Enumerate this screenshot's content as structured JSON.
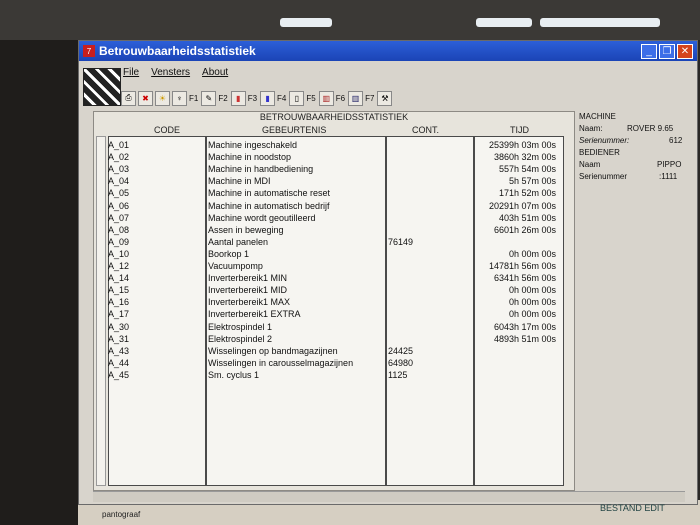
{
  "window": {
    "title": "Betrouwbaarheidsstatistiek"
  },
  "menu": {
    "items": [
      "File",
      "Vensters",
      "About"
    ]
  },
  "toolbar": {
    "fkeys": [
      "F1",
      "F2",
      "F3",
      "F4",
      "F5",
      "F6",
      "F7"
    ]
  },
  "table": {
    "heading": "BETROUWBAARHEIDSSTATISTIEK",
    "columns": {
      "code": "CODE",
      "event": "GEBEURTENIS",
      "count": "CONT.",
      "time": "TIJD"
    },
    "rows": [
      {
        "code": "A_01",
        "event": "Machine ingeschakeld",
        "count": "",
        "time": "25399h 03m 00s"
      },
      {
        "code": "A_02",
        "event": "Machine in noodstop",
        "count": "",
        "time": "3860h 32m 00s"
      },
      {
        "code": "A_03",
        "event": "Machine in handbediening",
        "count": "",
        "time": "557h 54m 00s"
      },
      {
        "code": "A_04",
        "event": "Machine in MDI",
        "count": "",
        "time": "5h 57m 00s"
      },
      {
        "code": "A_05",
        "event": "Machine in automatische reset",
        "count": "",
        "time": "171h 52m 00s"
      },
      {
        "code": "A_06",
        "event": "Machine in automatisch bedrijf",
        "count": "",
        "time": "20291h 07m 00s"
      },
      {
        "code": "A_07",
        "event": "Machine wordt geoutilleerd",
        "count": "",
        "time": "403h 51m 00s"
      },
      {
        "code": "A_08",
        "event": "Assen in beweging",
        "count": "",
        "time": "6601h 26m 00s"
      },
      {
        "code": "A_09",
        "event": "Aantal panelen",
        "count": "76149",
        "time": ""
      },
      {
        "code": "A_10",
        "event": "Boorkop 1",
        "count": "",
        "time": "0h 00m 00s"
      },
      {
        "code": "A_12",
        "event": "Vacuumpomp",
        "count": "",
        "time": "14781h 56m 00s"
      },
      {
        "code": "A_14",
        "event": "Inverterbereik1 MIN",
        "count": "",
        "time": "6341h 56m 00s"
      },
      {
        "code": "A_15",
        "event": "Inverterbereik1 MID",
        "count": "",
        "time": "0h 00m 00s"
      },
      {
        "code": "A_16",
        "event": "Inverterbereik1 MAX",
        "count": "",
        "time": "0h 00m 00s"
      },
      {
        "code": "A_17",
        "event": "Inverterbereik1 EXTRA",
        "count": "",
        "time": "0h 00m 00s"
      },
      {
        "code": "A_30",
        "event": "Elektrospindel 1",
        "count": "",
        "time": "6043h 17m 00s"
      },
      {
        "code": "A_31",
        "event": "Elektrospindel 2",
        "count": "",
        "time": "4893h 51m 00s"
      },
      {
        "code": "A_43",
        "event": "Wisselingen op bandmagazijnen",
        "count": "24425",
        "time": ""
      },
      {
        "code": "A_44",
        "event": "Wisselingen in carousselmagazijnen",
        "count": "64980",
        "time": ""
      },
      {
        "code": "A_45",
        "event": "Sm. cyclus 1",
        "count": "1125",
        "time": ""
      }
    ]
  },
  "info": {
    "machine_heading": "MACHINE",
    "machine_name_label": "Naam:",
    "machine_name": "ROVER 9.65",
    "machine_serial_label": "Serienummer:",
    "machine_serial": "612",
    "operator_heading": "BEDIENER",
    "operator_name_label": "Naam",
    "operator_name": "PIPPO",
    "operator_serial_label": "Serienummer",
    "operator_serial": ":1111"
  },
  "taskbar": {
    "label": "pantograaf"
  },
  "background": {
    "label": "BESTAND EDIT"
  },
  "colors": {
    "titlebar": "#1b44b6",
    "panel": "#e7e4dc",
    "close": "#d5441c"
  }
}
